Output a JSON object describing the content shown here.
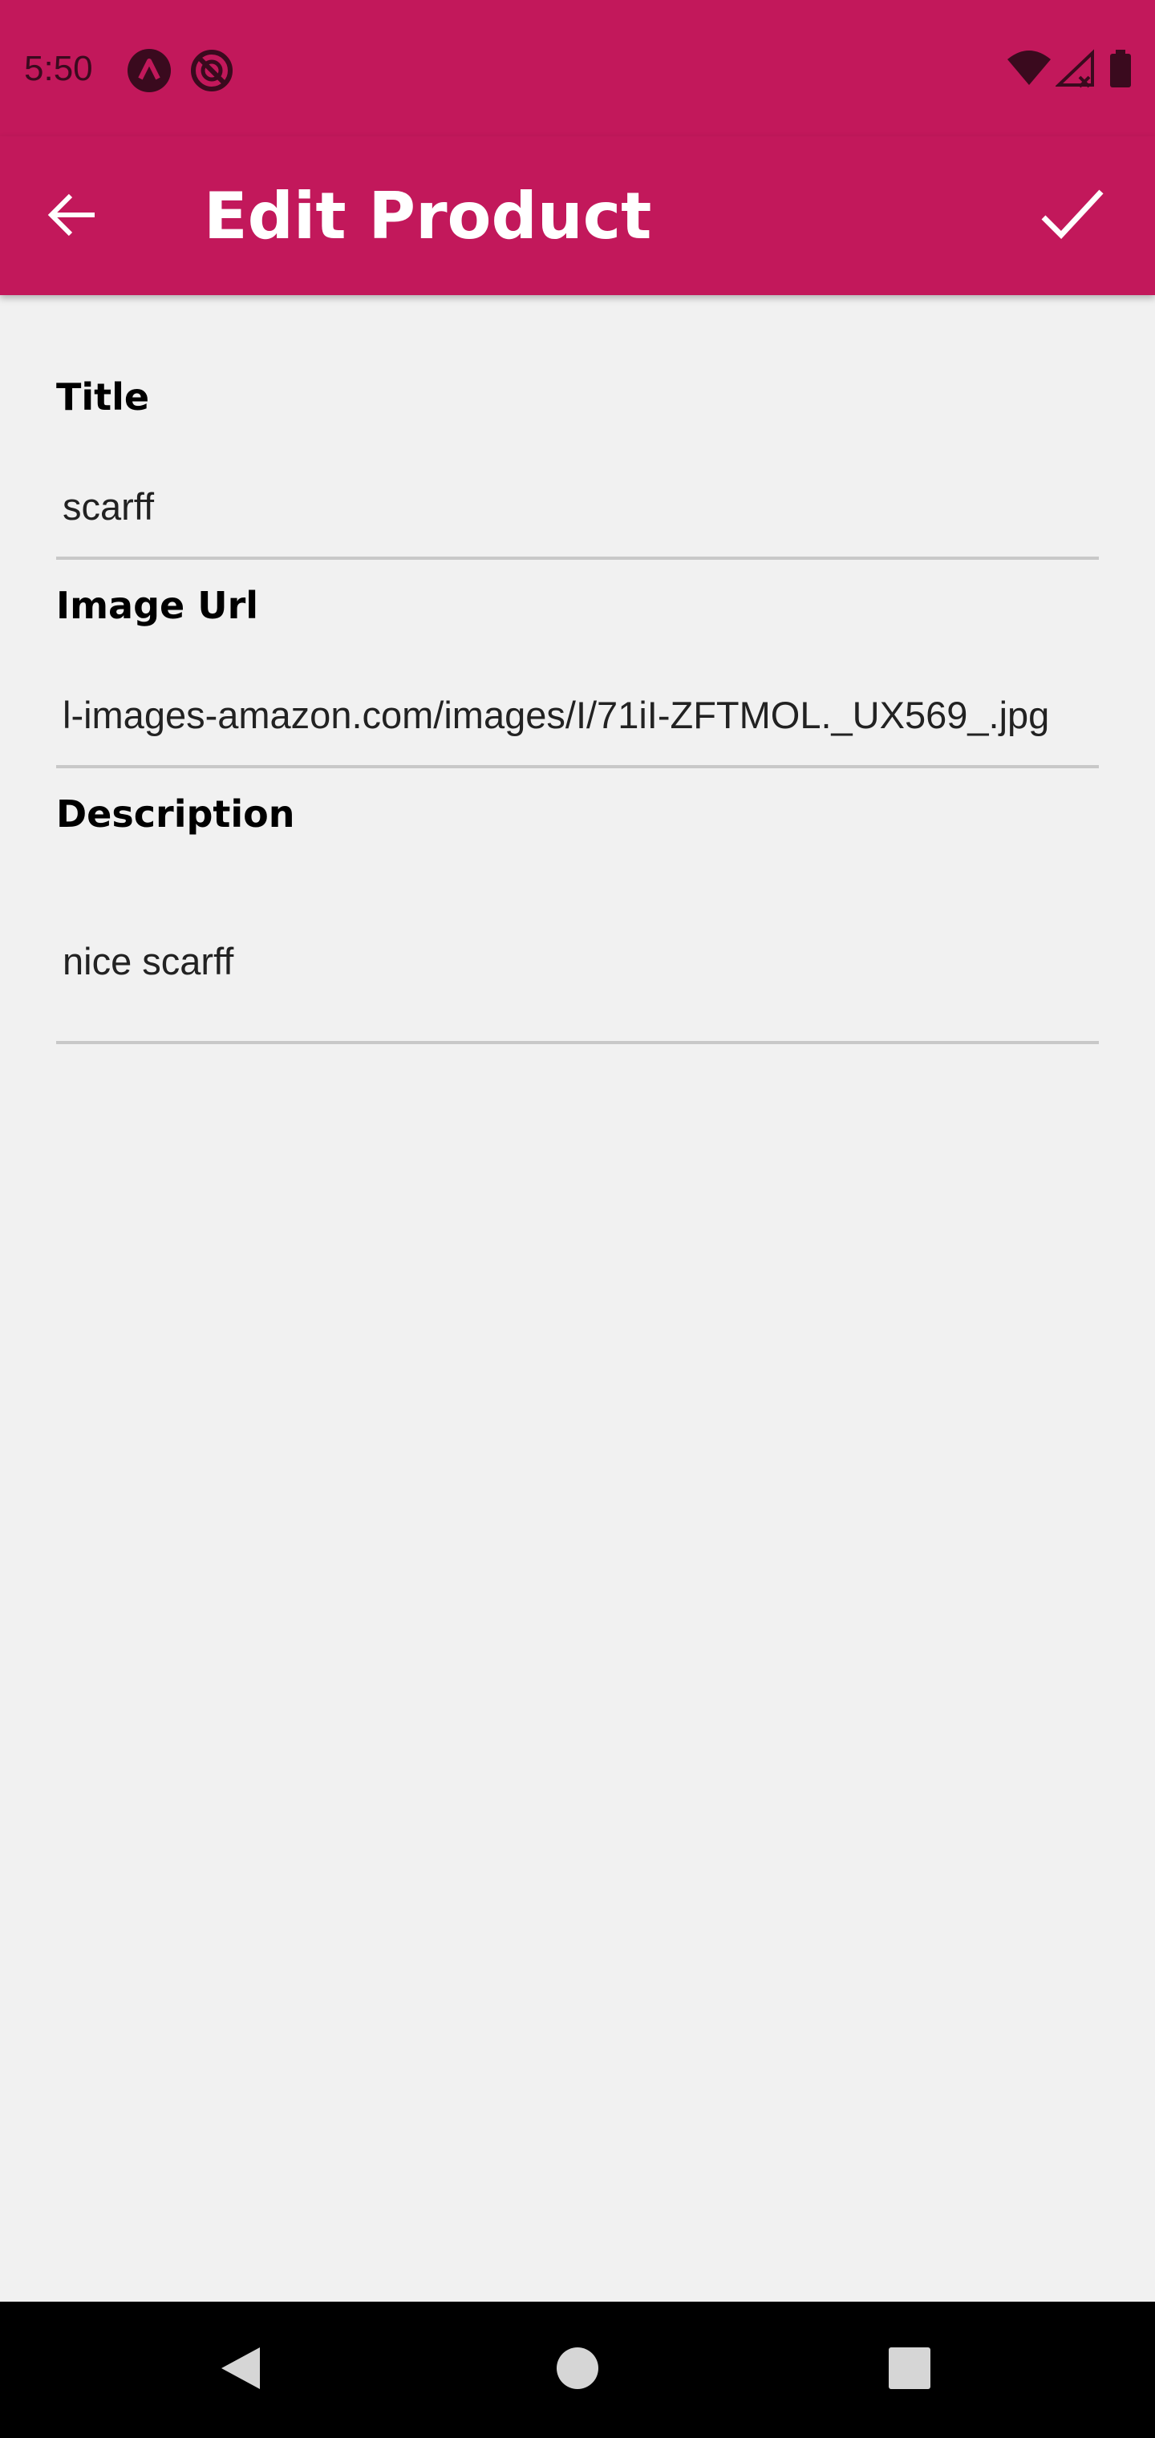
{
  "status_bar": {
    "time": "5:50",
    "left_icons": [
      "app-a-icon",
      "no-disturb-icon"
    ],
    "right_icons": [
      "wifi-icon",
      "cell-signal-icon",
      "battery-icon"
    ]
  },
  "app_bar": {
    "title": "Edit Product",
    "back_icon": "arrow-back-icon",
    "save_icon": "check-icon",
    "color": "#c2185b"
  },
  "form": {
    "title": {
      "label": "Title",
      "value": "scarff"
    },
    "image_url": {
      "label": "Image Url",
      "value": "l-images-amazon.com/images/I/71iI-ZFTMOL._UX569_.jpg"
    },
    "description": {
      "label": "Description",
      "value": "nice scarff"
    }
  },
  "nav_bar": {
    "icons": [
      "nav-back-icon",
      "nav-home-icon",
      "nav-recents-icon"
    ]
  }
}
